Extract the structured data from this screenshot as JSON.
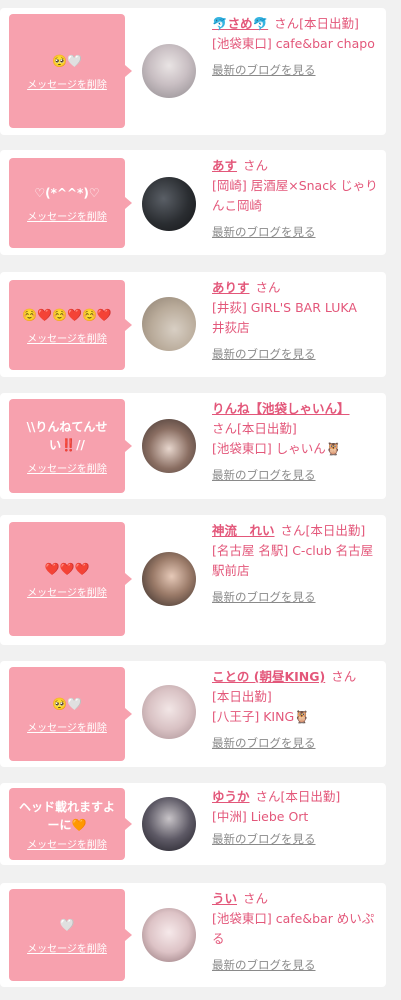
{
  "suffix": "さん",
  "delete_label": "メッセージを削除",
  "blog_label": "最新のブログを見る",
  "items": [
    {
      "message": "🥺🤍",
      "name": "🐬さめ🐬",
      "status": "[本日出勤]",
      "shop": "[池袋東口] cafe&bar chapo"
    },
    {
      "message": "♡(*^^*)♡",
      "name": "あす",
      "status": "",
      "shop": "[岡崎] 居酒屋×Snack じゃりんこ岡崎"
    },
    {
      "message": "☺️❤️☺️❤️☺️❤️",
      "name": "ありす",
      "status": "",
      "shop": "[井荻] GIRL'S BAR LUKA　井荻店"
    },
    {
      "message": "\\\\りんねてんせい‼️//",
      "name": "りんね【池袋しゃいん】",
      "status": "[本日出勤]",
      "shop": "[池袋東口] しゃいん🦉"
    },
    {
      "message": "❤️❤️❤️",
      "name": "神流　れい",
      "status": "[本日出勤]",
      "shop": "[名古屋 名駅] C-club 名古屋駅前店"
    },
    {
      "message": "🥺🤍",
      "name": "ことの (朝昼KING)",
      "status": "[本日出勤]",
      "shop": "[八王子] KING🦉"
    },
    {
      "message": "ヘッド載れますよーに🧡",
      "name": "ゆうか",
      "status": "[本日出勤]",
      "shop": "[中洲] Liebe Ort"
    },
    {
      "message": "🤍",
      "name": "うい",
      "status": "",
      "shop": "[池袋東口] cafe&bar めいぷる"
    }
  ]
}
